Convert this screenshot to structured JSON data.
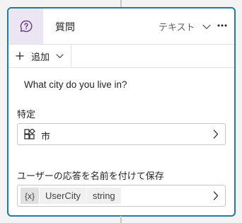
{
  "node": {
    "title": "質問",
    "type_select_value": "テキスト",
    "toolbar": {
      "add_label": "追加"
    },
    "prompt_text": "What city do you live in?",
    "identify": {
      "label": "特定",
      "entity_value": "市"
    },
    "save_response": {
      "label": "ユーザーの応答を名前を付けて保存",
      "variable_icon_text": "{x}",
      "variable_name": "UserCity",
      "variable_type": "string"
    }
  },
  "icons": {
    "header": "question-bubble-icon",
    "type_select": "chevron-down-icon",
    "more": "more-horizontal-icon",
    "add": "plus-icon",
    "entity": "entity-blocks-icon",
    "field_chevron": "chevron-right-icon"
  },
  "colors": {
    "card_border": "#1b7e9c",
    "header_icon_bg": "#ece6f4",
    "header_icon": "#6b3a8f"
  }
}
